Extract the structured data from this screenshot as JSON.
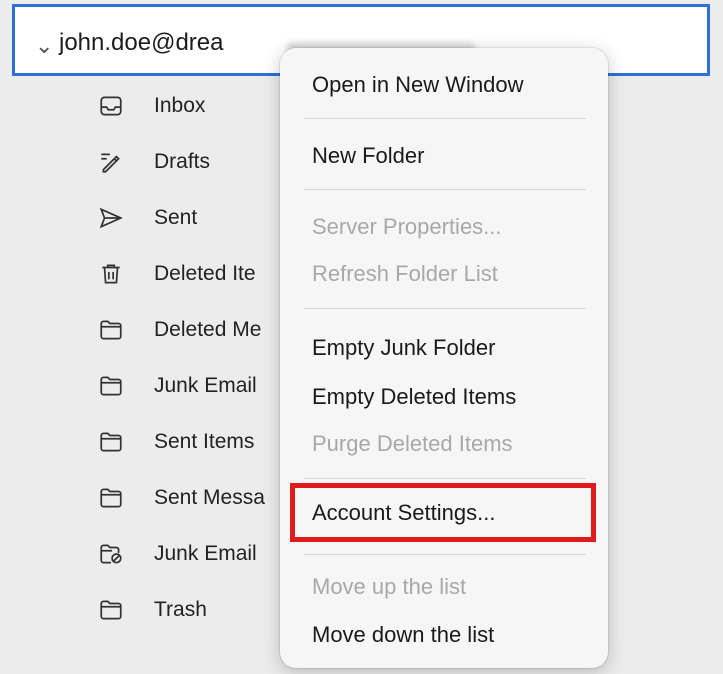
{
  "account": {
    "chevron": "⌄",
    "email": "john.doe@drea"
  },
  "folders": [
    {
      "label": "Inbox",
      "icon": "inbox-icon"
    },
    {
      "label": "Drafts",
      "icon": "drafts-pen-icon"
    },
    {
      "label": "Sent",
      "icon": "sent-arrow-icon"
    },
    {
      "label": "Deleted Ite",
      "icon": "trash-can-icon"
    },
    {
      "label": "Deleted Me",
      "icon": "folder-icon"
    },
    {
      "label": "Junk Email",
      "icon": "folder-icon"
    },
    {
      "label": "Sent Items",
      "icon": "folder-icon"
    },
    {
      "label": "Sent Messa",
      "icon": "folder-icon"
    },
    {
      "label": "Junk Email",
      "icon": "junk-folder-icon"
    },
    {
      "label": "Trash",
      "icon": "folder-icon"
    }
  ],
  "context_menu": {
    "items": [
      {
        "label": "Open in New Window",
        "enabled": true
      },
      {
        "label": "New Folder",
        "enabled": true
      },
      {
        "label": "Server Properties...",
        "enabled": false
      },
      {
        "label": "Refresh Folder List",
        "enabled": false
      },
      {
        "label": "Empty Junk Folder",
        "enabled": true
      },
      {
        "label": "Empty Deleted Items",
        "enabled": true
      },
      {
        "label": "Purge Deleted Items",
        "enabled": false
      },
      {
        "label": "Account Settings...",
        "enabled": true,
        "highlighted": true
      },
      {
        "label": "Move up the list",
        "enabled": false
      },
      {
        "label": "Move down the list",
        "enabled": true
      }
    ],
    "highlight_color": "#e01b1b"
  },
  "colors": {
    "selection_border": "#2f6fd6",
    "disabled_text": "#a8a8a8"
  }
}
